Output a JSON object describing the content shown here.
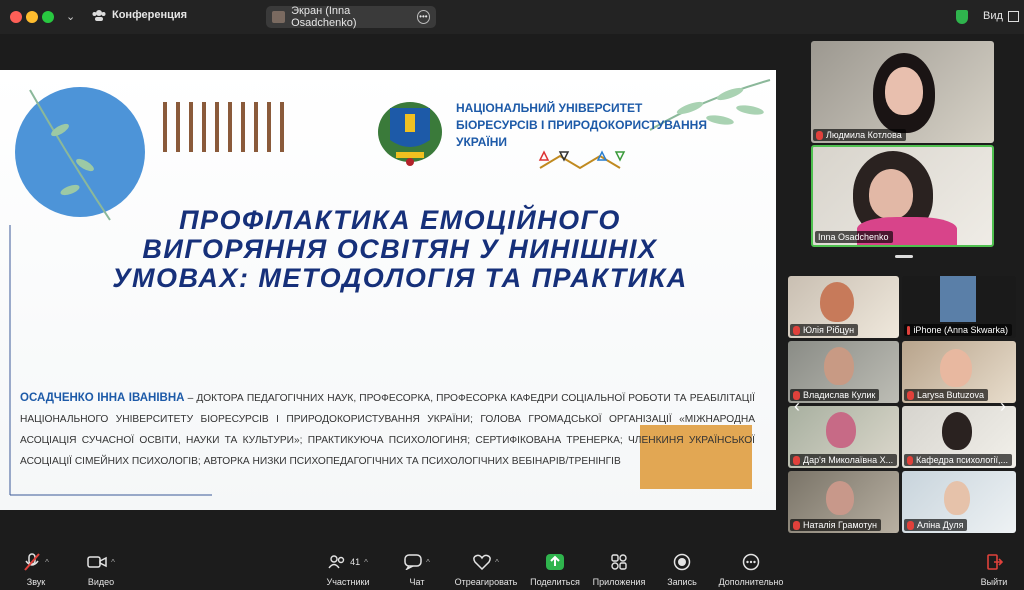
{
  "window": {
    "meeting_title": "Конференция",
    "screen_share_label": "Экран (Inna Osadchenko)",
    "view_label": "Вид",
    "colors": {
      "bg": "#1c1c1c",
      "share_accent": "#2fb44d"
    }
  },
  "slide": {
    "university": [
      "НАЦІОНАЛЬНИЙ УНІВЕРСИТЕТ",
      "БІОРЕСУРСІВ І ПРИРОДОКОРИСТУВАННЯ",
      "УКРАЇНИ"
    ],
    "title_lines": [
      "ПРОФІЛАКТИКА ЕМОЦІЙНОГО",
      "ВИГОРЯННЯ ОСВІТЯН У НИНІШНІХ",
      "УМОВАХ: МЕТОДОЛОГІЯ ТА ПРАКТИКА"
    ],
    "author_name": "ОСАДЧЕНКО ІННА ІВАНІВНА",
    "author_bio": " – доктора педагогічних наук, професорка, професорка кафедри соціальної роботи та реабілітації національного університету біоресурсів і природокористування україни; голова громадської організації «Міжнародна асоціація сучасної освіти, науки та культури»; практикуюча психологиня; сертифікована тренерка; членкиня української асоціації сімейних психологів; авторка низки психопедагогічних та психологічних вебінарів/тренінгів"
  },
  "speakers": [
    {
      "name": "Людмила Котлова"
    },
    {
      "name": "Inna Osadchenko"
    }
  ],
  "gallery": [
    {
      "name": "Юлія Рібцун"
    },
    {
      "name": "iPhone (Anna Skwarka)"
    },
    {
      "name": "Владислав Кулик"
    },
    {
      "name": "Larysa Butuzova"
    },
    {
      "name": "Дар'я Миколаївна Х..."
    },
    {
      "name": "Кафедра психології,..."
    },
    {
      "name": "Наталія Грамотун"
    },
    {
      "name": "Аліна Дуля"
    }
  ],
  "toolbar": {
    "audio": "Звук",
    "video": "Видео",
    "participants": "Участники",
    "participants_count": "41",
    "chat": "Чат",
    "react": "Отреагировать",
    "share": "Поделиться",
    "apps": "Приложения",
    "record": "Запись",
    "more": "Дополнительно",
    "leave": "Выйти"
  }
}
